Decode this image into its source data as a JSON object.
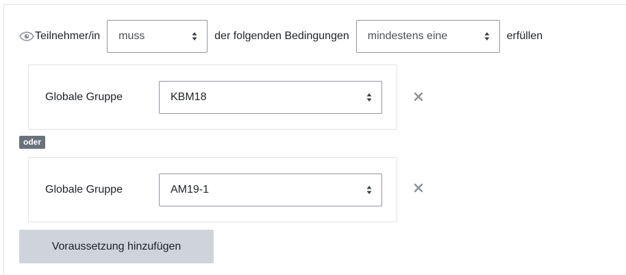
{
  "header": {
    "participant_label": "Teilnehmer/in",
    "muss_value": "muss",
    "middle_label": "der folgenden Bedingungen",
    "mindestens_value": "mindestens eine",
    "end_label": "erfüllen"
  },
  "conditions": [
    {
      "label": "Globale Gruppe",
      "value": "KBM18"
    },
    {
      "label": "Globale Gruppe",
      "value": "AM19-1"
    }
  ],
  "connector": "oder",
  "add_button_label": "Voraussetzung hinzufügen",
  "icons": {
    "eye": "eye-icon",
    "caret": "sort-caret-icon",
    "remove": "close-icon"
  },
  "colors": {
    "badge_bg": "#6a737b",
    "button_bg": "#ced4da",
    "border": "#dee2e6",
    "select_border": "#8f959e"
  }
}
